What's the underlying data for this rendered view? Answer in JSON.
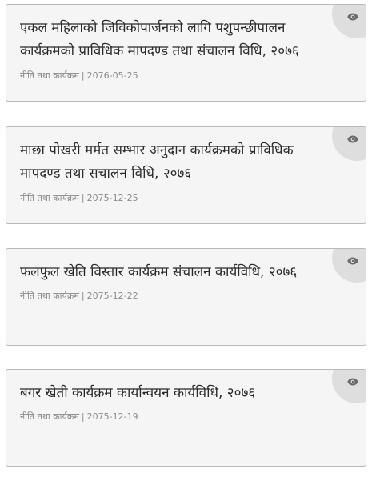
{
  "items": [
    {
      "title": "एकल महिलाको जिविकोपार्जनको लागि पशुपन्छीपालन कार्यक्रमको प्राविधिक मापदण्ड तथा संचालन विधि, २०७६",
      "category": "नीति तथा कार्यक्रम",
      "separator": "|",
      "date": "2076-05-25",
      "icon": "eye-icon"
    },
    {
      "title": "माछा पोखरी मर्मत सम्भार अनुदान कार्यक्रमको प्राविधिक मापदण्ड तथा सचालन विधि, २०७६",
      "category": "नीति तथा कार्यक्रम",
      "separator": "|",
      "date": "2075-12-25",
      "icon": "eye-icon"
    },
    {
      "title": "फलफुल खेति विस्तार कार्यक्रम संचालन कार्यविधि, २०७६",
      "category": "नीति तथा कार्यक्रम",
      "separator": "|",
      "date": "2075-12-22",
      "icon": "eye-icon"
    },
    {
      "title": "बगर खेती कार्यक्रम कार्यान्वयन कार्यविधि, २०७६",
      "category": "नीति तथा कार्यक्रम",
      "separator": "|",
      "date": "2075-12-19",
      "icon": "eye-icon"
    }
  ],
  "colors": {
    "card_background": "#f5f5f5",
    "card_border": "#b9b9b9",
    "corner_background": "#dedede",
    "title_text": "#2b2b2b",
    "meta_text": "#8a8a8a",
    "icon": "#6b6b6b"
  }
}
